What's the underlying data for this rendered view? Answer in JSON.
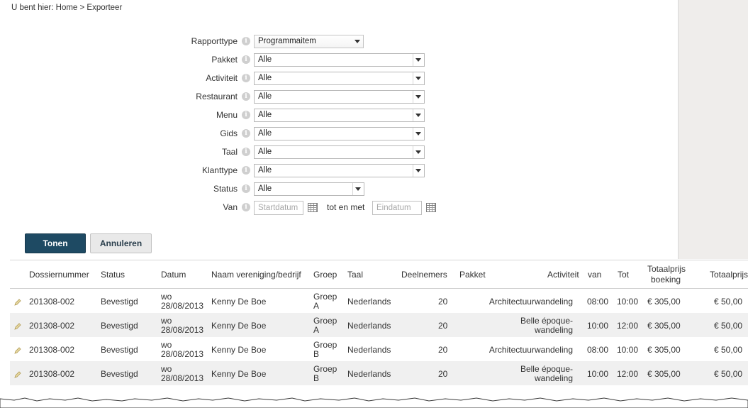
{
  "breadcrumb": "U bent hier: Home > Exporteer",
  "form": {
    "rapporttype": {
      "label": "Rapporttype",
      "value": "Programmaitem"
    },
    "pakket": {
      "label": "Pakket",
      "value": "Alle"
    },
    "activiteit": {
      "label": "Activiteit",
      "value": "Alle"
    },
    "restaurant": {
      "label": "Restaurant",
      "value": "Alle"
    },
    "menu": {
      "label": "Menu",
      "value": "Alle"
    },
    "gids": {
      "label": "Gids",
      "value": "Alle"
    },
    "taal": {
      "label": "Taal",
      "value": "Alle"
    },
    "klanttype": {
      "label": "Klanttype",
      "value": "Alle"
    },
    "status": {
      "label": "Status",
      "value": "Alle"
    },
    "van": {
      "label": "Van",
      "start_placeholder": "Startdatum",
      "tot_label": "tot en met",
      "end_placeholder": "Eindatum"
    }
  },
  "buttons": {
    "show": "Tonen",
    "cancel": "Annuleren"
  },
  "table": {
    "headers": {
      "dossiernummer": "Dossiernummer",
      "status": "Status",
      "datum": "Datum",
      "naam": "Naam vereniging/bedrijf",
      "groep": "Groep",
      "taal": "Taal",
      "deelnemers": "Deelnemers",
      "pakket": "Pakket",
      "activiteit": "Activiteit",
      "van": "van",
      "tot": "Tot",
      "totaalprijs_boeking_1": "Totaalprijs",
      "totaalprijs_boeking_2": "boeking",
      "totaalprijs": "Totaalprijs"
    },
    "rows": [
      {
        "dossier": "201308-002",
        "status": "Bevestigd",
        "dag": "wo",
        "datum": "28/08/2013",
        "naam": "Kenny De Boe",
        "groep1": "Groep",
        "groep2": "A",
        "taal": "Nederlands",
        "deelnemers": "20",
        "act1": "Architectuurwandeling",
        "act2": "",
        "van": "08:00",
        "tot": "10:00",
        "boeking": "€ 305,00",
        "prijs": "€ 50,00"
      },
      {
        "dossier": "201308-002",
        "status": "Bevestigd",
        "dag": "wo",
        "datum": "28/08/2013",
        "naam": "Kenny De Boe",
        "groep1": "Groep",
        "groep2": "A",
        "taal": "Nederlands",
        "deelnemers": "20",
        "act1": "Belle époque-",
        "act2": "wandeling",
        "van": "10:00",
        "tot": "12:00",
        "boeking": "€ 305,00",
        "prijs": "€ 50,00"
      },
      {
        "dossier": "201308-002",
        "status": "Bevestigd",
        "dag": "wo",
        "datum": "28/08/2013",
        "naam": "Kenny De Boe",
        "groep1": "Groep",
        "groep2": "B",
        "taal": "Nederlands",
        "deelnemers": "20",
        "act1": "Architectuurwandeling",
        "act2": "",
        "van": "08:00",
        "tot": "10:00",
        "boeking": "€ 305,00",
        "prijs": "€ 50,00"
      },
      {
        "dossier": "201308-002",
        "status": "Bevestigd",
        "dag": "wo",
        "datum": "28/08/2013",
        "naam": "Kenny De Boe",
        "groep1": "Groep",
        "groep2": "B",
        "taal": "Nederlands",
        "deelnemers": "20",
        "act1": "Belle époque-",
        "act2": "wandeling",
        "van": "10:00",
        "tot": "12:00",
        "boeking": "€ 305,00",
        "prijs": "€ 50,00"
      }
    ]
  }
}
